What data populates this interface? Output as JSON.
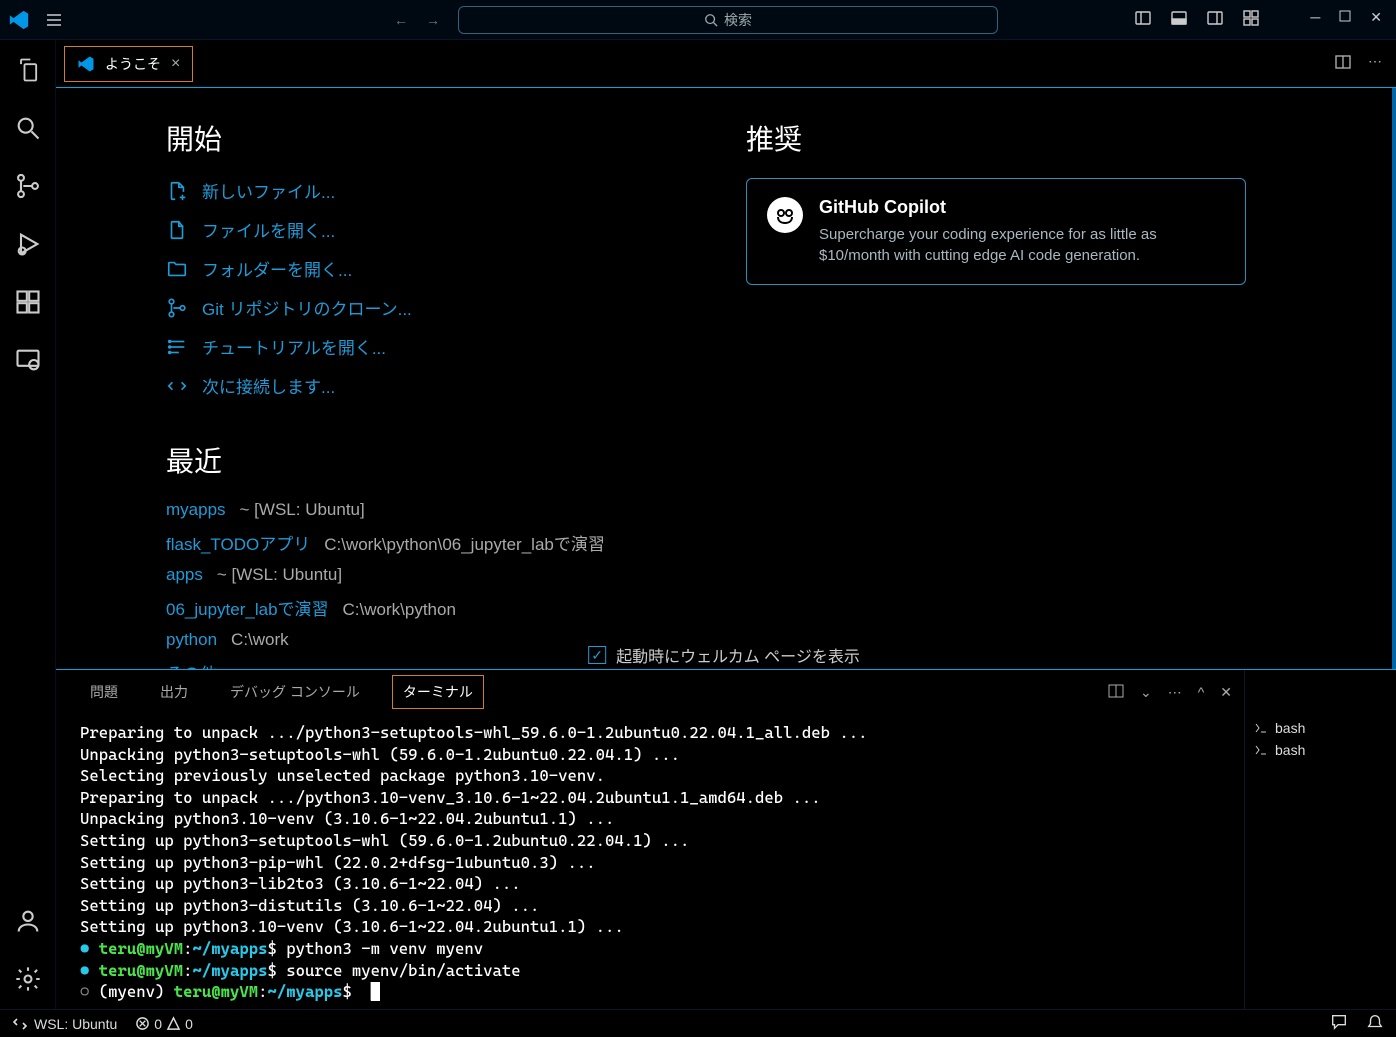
{
  "search_placeholder": "検索",
  "tab_title": "ようこそ",
  "sections": {
    "start": "開始",
    "recent": "最近",
    "reco": "推奨"
  },
  "start_items": [
    "新しいファイル...",
    "ファイルを開く...",
    "フォルダーを開く...",
    "Git リポジトリのクローン...",
    "チュートリアルを開く...",
    "次に接続します..."
  ],
  "recent": [
    {
      "name": "myapps",
      "path": "~ [WSL: Ubuntu]"
    },
    {
      "name": "flask_TODOアプリ",
      "path": "C:\\work\\python\\06_jupyter_labで演習"
    },
    {
      "name": "apps",
      "path": "~ [WSL: Ubuntu]"
    },
    {
      "name": "06_jupyter_labで演習",
      "path": "C:\\work\\python"
    },
    {
      "name": "python",
      "path": "C:\\work"
    }
  ],
  "recent_more": "その他...",
  "copilot": {
    "title": "GitHub Copilot",
    "desc": "Supercharge your coding experience for as little as $10/month with cutting edge AI code generation."
  },
  "show_on_startup": "起動時にウェルカム ページを表示",
  "panel_tabs": [
    "問題",
    "出力",
    "デバッグ コンソール",
    "ターミナル"
  ],
  "terminal_lines_plain": [
    "Preparing to unpack .../python3-setuptools-whl_59.6.0-1.2ubuntu0.22.04.1_all.deb ...",
    "Unpacking python3-setuptools-whl (59.6.0-1.2ubuntu0.22.04.1) ...",
    "Selecting previously unselected package python3.10-venv.",
    "Preparing to unpack .../python3.10-venv_3.10.6-1~22.04.2ubuntu1.1_amd64.deb ...",
    "Unpacking python3.10-venv (3.10.6-1~22.04.2ubuntu1.1) ...",
    "Setting up python3-setuptools-whl (59.6.0-1.2ubuntu0.22.04.1) ...",
    "Setting up python3-pip-whl (22.0.2+dfsg-1ubuntu0.3) ...",
    "Setting up python3-lib2to3 (3.10.6-1~22.04) ...",
    "Setting up python3-distutils (3.10.6-1~22.04) ...",
    "Setting up python3.10-venv (3.10.6-1~22.04.2ubuntu1.1) ..."
  ],
  "prompts": [
    {
      "user": "teru@myVM",
      "path": "~/myapps",
      "cmd": "python3 -m venv myenv",
      "env": ""
    },
    {
      "user": "teru@myVM",
      "path": "~/myapps",
      "cmd": "source myenv/bin/activate",
      "env": ""
    },
    {
      "user": "teru@myVM",
      "path": "~/myapps",
      "cmd": "",
      "env": "(myenv) "
    }
  ],
  "terminal_instances": [
    "bash",
    "bash"
  ],
  "status": {
    "remote": "WSL: Ubuntu",
    "errors": "0",
    "warnings": "0"
  }
}
